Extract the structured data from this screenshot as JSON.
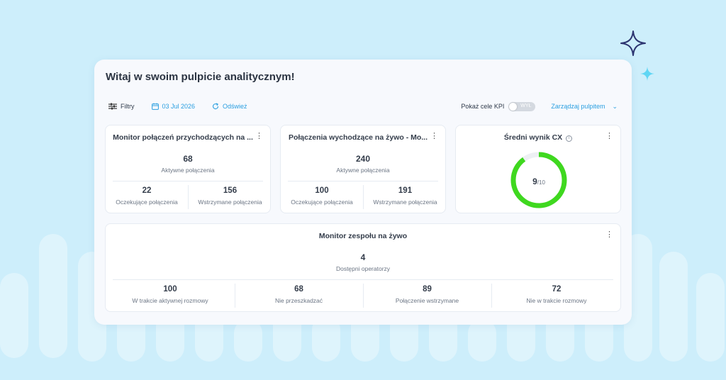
{
  "title": "Witaj w swoim pulpicie analitycznym!",
  "toolbar": {
    "filters_label": "Filtry",
    "date": "03 Jul 2026",
    "refresh_label": "Odśwież",
    "kpi_label": "Pokaż cele KPI",
    "kpi_toggle_state": "WYŁ",
    "manage_label": "Zarządzaj pulpitem"
  },
  "cards": {
    "incoming": {
      "title": "Monitor połączeń przychodzących na ...",
      "main_value": "68",
      "main_label": "Aktywne połączenia",
      "stat1_value": "22",
      "stat1_label": "Oczekujące połączenia",
      "stat2_value": "156",
      "stat2_label": "Wstrzymane połączenia"
    },
    "outgoing": {
      "title": "Połączenia wychodzące na żywo - Mo...",
      "main_value": "240",
      "main_label": "Aktywne połączenia",
      "stat1_value": "100",
      "stat1_label": "Oczekujące połączenia",
      "stat2_value": "191",
      "stat2_label": "Wstrzymane połączenia"
    },
    "cx": {
      "title": "Średni wynik CX",
      "score": "9",
      "score_max": "/10",
      "fraction": 0.9,
      "ring_color": "#3fd81f"
    },
    "team": {
      "title": "Monitor zespołu na żywo",
      "main_value": "4",
      "main_label": "Dostępni operatorzy",
      "stats": [
        {
          "value": "100",
          "label": "W trakcie aktywnej rozmowy"
        },
        {
          "value": "68",
          "label": "Nie przeszkadzać"
        },
        {
          "value": "89",
          "label": "Połączenie wstrzymane"
        },
        {
          "value": "72",
          "label": "Nie w trakcie rozmowy"
        }
      ]
    }
  },
  "colors": {
    "accent": "#2a9fe0",
    "background": "#cdeefb"
  }
}
